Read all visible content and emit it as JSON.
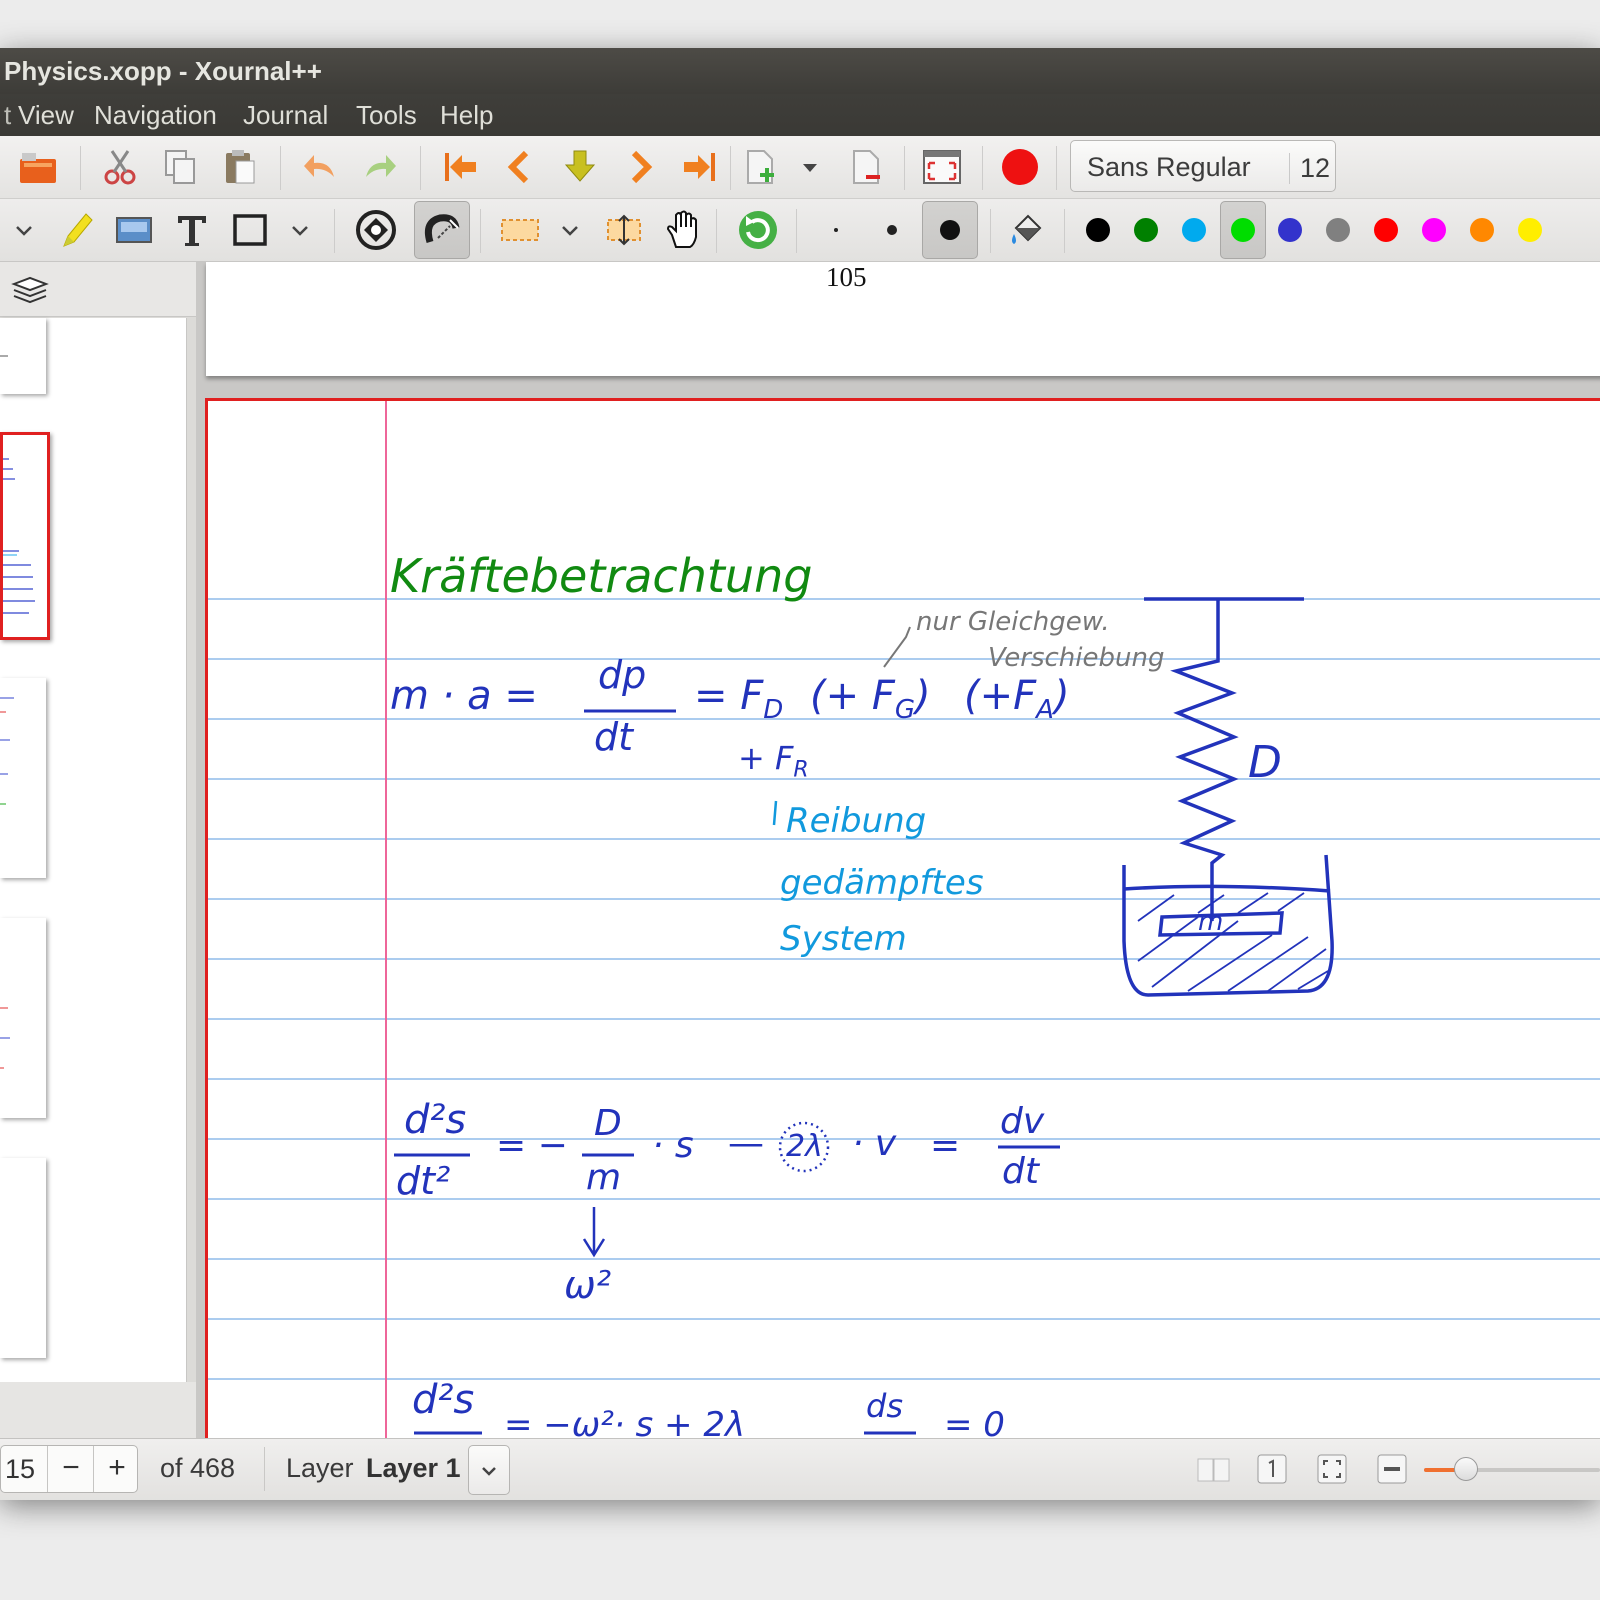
{
  "window": {
    "title": "Physics.xopp - Xournal++"
  },
  "menu": [
    "View",
    "Navigation",
    "Journal",
    "Tools",
    "Help"
  ],
  "toolbar1": {
    "icons": [
      "open-icon",
      "cut-icon",
      "copy-icon",
      "paste-icon",
      "undo-icon",
      "redo-icon",
      "first-page-icon",
      "previous-page-icon",
      "goto-page-icon",
      "next-page-icon",
      "last-page-icon",
      "insert-page-icon",
      "delete-page-icon",
      "fullscreen-icon",
      "record-icon"
    ],
    "font_name": "Sans Regular",
    "font_size": "12"
  },
  "toolbar2": {
    "tools": [
      "highlighter-icon",
      "image-icon",
      "text-tool-icon",
      "rectangle-icon",
      "eraser-mode-icon",
      "snap-icon",
      "select-rect-icon",
      "vertical-space-icon",
      "hand-icon",
      "refresh-icon"
    ],
    "colors": [
      "#000000",
      "#008000",
      "#00aaee",
      "#00dd00",
      "#3333cc",
      "#808080",
      "#ff0000",
      "#ff00ff",
      "#ff8800",
      "#ffee00"
    ],
    "selected_color": "#00dd00"
  },
  "canvas": {
    "prev_page_number": "105",
    "notes": {
      "heading": "Kräftebetrachtung",
      "eq1_lhs": "m · a =",
      "eq1_frac_num": "dp",
      "eq1_frac_den": "dt",
      "eq1_rhs": "= F",
      "eq1_FD_sub": "D",
      "eq1_plus_FG": "(+ F",
      "eq1_FG_sub": "G",
      "eq1_FG_close": ")",
      "eq1_FA": "(+F",
      "eq1_FA_sub": "A",
      "eq1_FA_close": ")",
      "fr": "+ F",
      "fr_sub": "R",
      "annot1": "nur Gleichgew.",
      "annot2": "Verschiebung",
      "reibung": "Reibung",
      "gedaempft1": "gedämpftes",
      "gedaempft2": "System",
      "spring_label": "D",
      "mass_label": "m",
      "eq2_num": "d²s",
      "eq2_den": "dt²",
      "eq2_mid": "= −",
      "eq2_D": "D",
      "eq2_m": "m",
      "eq2_s": "· s",
      "eq2_minus": "—",
      "eq2_lambda": "2λ",
      "eq2_v": "· v",
      "eq2_eq": "=",
      "eq2_dv": "dv",
      "eq2_dt": "dt",
      "omega": "ω²",
      "eq3_num": "d²s",
      "eq3_tail": "= −ω²· s  + 2λ",
      "eq3_ds": "ds",
      "eq3_zero": "= 0"
    }
  },
  "status": {
    "page_value": "15",
    "minus": "−",
    "plus": "+",
    "of_pages": "of 468",
    "layer_label": "Layer",
    "layer_value": "Layer 1"
  }
}
